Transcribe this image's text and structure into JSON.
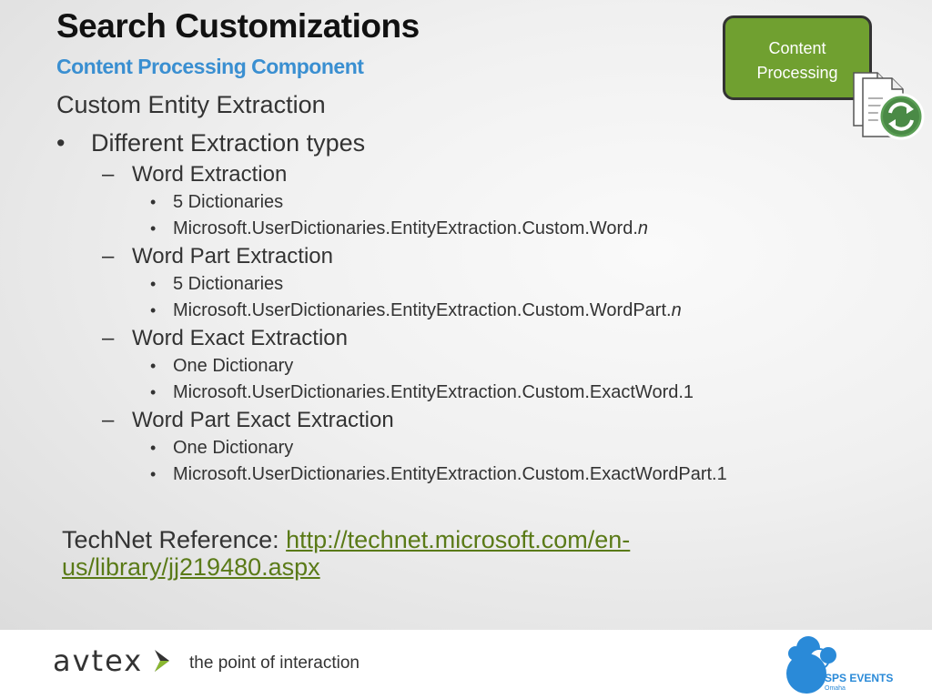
{
  "slide": {
    "title": "Search Customizations",
    "subtitle": "Content Processing Component",
    "heading": "Custom Entity Extraction",
    "bullet": "Different Extraction types",
    "sections": [
      {
        "name": "Word Extraction",
        "items": [
          {
            "text": "5 Dictionaries",
            "suffix": ""
          },
          {
            "text": "Microsoft.UserDictionaries.EntityExtraction.Custom.Word.",
            "suffix": "n"
          }
        ]
      },
      {
        "name": "Word Part Extraction",
        "items": [
          {
            "text": "5 Dictionaries",
            "suffix": ""
          },
          {
            "text": "Microsoft.UserDictionaries.EntityExtraction.Custom.WordPart.",
            "suffix": "n"
          }
        ]
      },
      {
        "name": "Word Exact Extraction",
        "items": [
          {
            "text": "One Dictionary",
            "suffix": ""
          },
          {
            "text": "Microsoft.UserDictionaries.EntityExtraction.Custom.ExactWord.1",
            "suffix": ""
          }
        ]
      },
      {
        "name": "Word Part Exact Extraction",
        "items": [
          {
            "text": "One Dictionary",
            "suffix": ""
          },
          {
            "text": "Microsoft.UserDictionaries.EntityExtraction.Custom.ExactWordPart.1",
            "suffix": ""
          }
        ]
      }
    ],
    "reference_label": "TechNet Reference: ",
    "reference_link": "http://technet.microsoft.com/en-us/library/jj219480.aspx",
    "badge_line1": "Content",
    "badge_line2": "Processing",
    "docs_icon": "document-refresh-icon"
  },
  "footer": {
    "logo_text": "avtex",
    "tagline": "the point of interaction",
    "sps_line1": "SPS EVENTS",
    "sps_line2": "Omaha"
  },
  "colors": {
    "subtitle": "#3a8fd1",
    "badge": "#70a030",
    "link": "#5a7a17",
    "sps_blue": "#2a8ad8"
  }
}
